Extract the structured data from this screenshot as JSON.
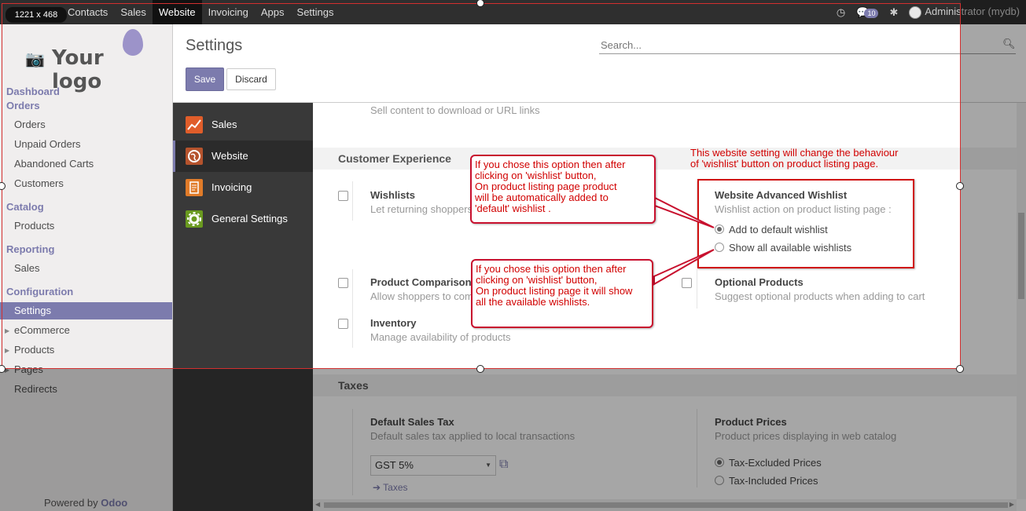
{
  "topnav": {
    "menu": [
      "Contacts",
      "Sales",
      "Website",
      "Invoicing",
      "Apps",
      "Settings"
    ],
    "active": "Website",
    "messages_count": "10",
    "user": "Administrator (mydb)"
  },
  "overlay": {
    "size_label": "1221 x 468"
  },
  "sidebar": {
    "logo_text": "Your logo",
    "dashboard": "Dashboard",
    "orders_header": "Orders",
    "orders_items": [
      "Orders",
      "Unpaid Orders",
      "Abandoned Carts",
      "Customers"
    ],
    "catalog_header": "Catalog",
    "catalog_items": [
      "Products"
    ],
    "reporting_header": "Reporting",
    "reporting_items": [
      "Sales"
    ],
    "configuration_header": "Configuration",
    "config_selected": "Settings",
    "config_items": [
      "eCommerce",
      "Products",
      "Pages",
      "Redirects"
    ],
    "powered_by": "Powered by",
    "powered_brand": "Odoo"
  },
  "cpanel": {
    "title": "Settings",
    "save_label": "Save",
    "discard_label": "Discard",
    "search_placeholder": "Search..."
  },
  "apps": [
    {
      "label": "Sales",
      "color": "#e05d2a"
    },
    {
      "label": "Website",
      "color": "#b5532d"
    },
    {
      "label": "Invoicing",
      "color": "#e07b29"
    },
    {
      "label": "General Settings",
      "color": "#6a9a1f"
    }
  ],
  "content": {
    "sell_content_desc": "Sell content to download or URL links",
    "customer_experience": "Customer Experience",
    "wishlists_title": "Wishlists",
    "wishlists_desc": "Let returning shoppers",
    "comparison_title": "Product Comparison",
    "comparison_desc": "Allow shoppers to com",
    "inventory_title": "Inventory",
    "inventory_desc": "Manage availability of products",
    "adv_wishlist_title": "Website Advanced Wishlist",
    "adv_wishlist_desc": "Wishlist action on product listing page :",
    "radio_add_default": "Add to default wishlist",
    "radio_show_all": "Show all available wishlists",
    "optional_title": "Optional Products",
    "optional_desc": "Suggest optional products when adding to cart",
    "taxes_header": "Taxes",
    "default_tax_title": "Default Sales Tax",
    "default_tax_desc": "Default sales tax applied to local transactions",
    "tax_value": "GST 5%",
    "taxes_link": "Taxes",
    "prices_title": "Product Prices",
    "prices_desc": "Product prices displaying in web catalog",
    "price_excluded": "Tax-Excluded Prices",
    "price_included": "Tax-Included Prices"
  },
  "annotations": {
    "top_note": "This website setting will change the behaviour\n of 'wishlist' button on product listing page.",
    "callout1": "If  you chose this  option then after\nclicking on 'wishlist' button,\nOn product listing page  product\n will be automatically added to\n'default' wishlist .",
    "callout2": "If you chose this option then after\nclicking on  'wishlist' button,\nOn product listing page it will show\nall the available wishlists."
  }
}
